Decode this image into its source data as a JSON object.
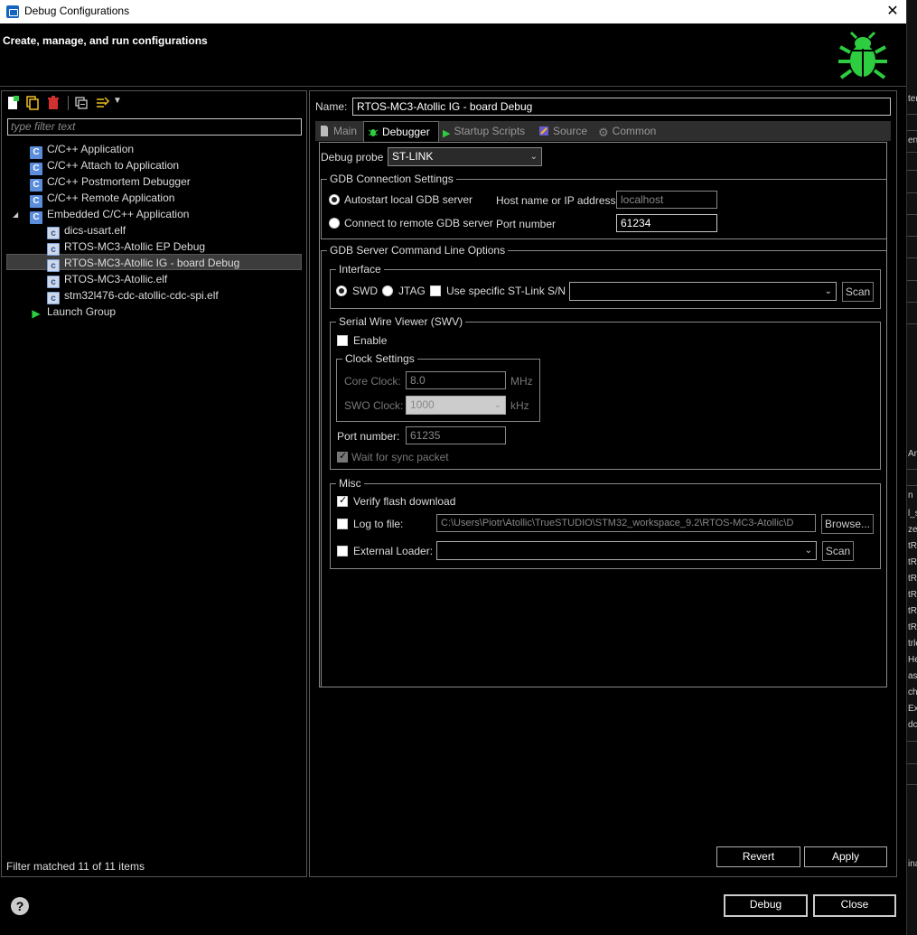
{
  "window": {
    "title": "Debug Configurations",
    "close_glyph": "✕",
    "header_title": "Create, manage, and run configurations",
    "header_icon": "bug-icon",
    "accent": "#1db954"
  },
  "left": {
    "filter_placeholder": "type filter text",
    "tree": [
      {
        "label": "C/C++ Application",
        "icon": "c-config-icon"
      },
      {
        "label": "C/C++ Attach to Application",
        "icon": "c-config-icon"
      },
      {
        "label": "C/C++ Postmortem Debugger",
        "icon": "c-config-icon"
      },
      {
        "label": "C/C++ Remote Application",
        "icon": "c-config-icon"
      },
      {
        "label": "Embedded C/C++ Application",
        "icon": "c-config-icon"
      },
      {
        "label": "dics-usart.elf",
        "icon": "c-file-icon"
      },
      {
        "label": "RTOS-MC3-Atollic EP Debug",
        "icon": "c-file-icon"
      },
      {
        "label": "RTOS-MC3-Atollic IG - board Debug",
        "icon": "c-file-icon"
      },
      {
        "label": "RTOS-MC3-Atollic.elf",
        "icon": "c-file-icon"
      },
      {
        "label": "stm32l476-cdc-atollic-cdc-spi.elf",
        "icon": "c-file-icon"
      },
      {
        "label": "Launch Group",
        "icon": "launch-group-icon"
      }
    ],
    "filter_status": "Filter matched 11 of 11 items"
  },
  "config": {
    "name_label": "Name:",
    "name_value": "RTOS-MC3-Atollic IG - board Debug",
    "tabs": [
      "Main",
      "Debugger",
      "Startup Scripts",
      "Source",
      "Common"
    ],
    "debug_probe_label": "Debug probe",
    "debug_probe_value": "ST-LINK",
    "gdb_conn": {
      "title": "GDB Connection Settings",
      "autostart": "Autostart local GDB server",
      "connect_remote": "Connect to remote GDB server",
      "host_label": "Host name or IP address",
      "host_value": "localhost",
      "port_label": "Port number",
      "port_value": "61234"
    },
    "gdb_server": {
      "title": "GDB Server Command Line Options",
      "interface_title": "Interface",
      "swd": "SWD",
      "jtag": "JTAG",
      "use_specific": "Use specific ST-Link S/N",
      "scan": "Scan",
      "swv_title": "Serial Wire Viewer (SWV)",
      "enable": "Enable",
      "clock_title": "Clock Settings",
      "core_clock_label": "Core Clock:",
      "core_clock_value": "8.0",
      "core_clock_unit": "MHz",
      "swo_clock_label": "SWO Clock:",
      "swo_clock_value": "1000",
      "swo_clock_unit": "kHz",
      "port_number_label": "Port number:",
      "port_number_value": "61235",
      "wait_sync": "Wait for sync packet",
      "misc_title": "Misc",
      "verify_flash": "Verify flash download",
      "log_to_file": "Log to file:",
      "log_path": "C:\\Users\\Piotr\\Atollic\\TrueSTUDIO\\STM32_workspace_9.2\\RTOS-MC3-Atollic\\D",
      "browse": "Browse...",
      "external_loader": "External Loader:",
      "scan2": "Scan"
    },
    "revert": "Revert",
    "apply": "Apply"
  },
  "footer": {
    "help": "?",
    "debug": "Debug",
    "close": "Close"
  },
  "bg_fragments": [
    "ter",
    "en",
    "Ar",
    "n",
    "l_s",
    "ze",
    "tRa",
    "tRa",
    "tRa",
    "tRa",
    "tRa",
    "tRa",
    "trle",
    "He",
    "as",
    "cha",
    "Ex",
    "dc",
    "ina"
  ]
}
